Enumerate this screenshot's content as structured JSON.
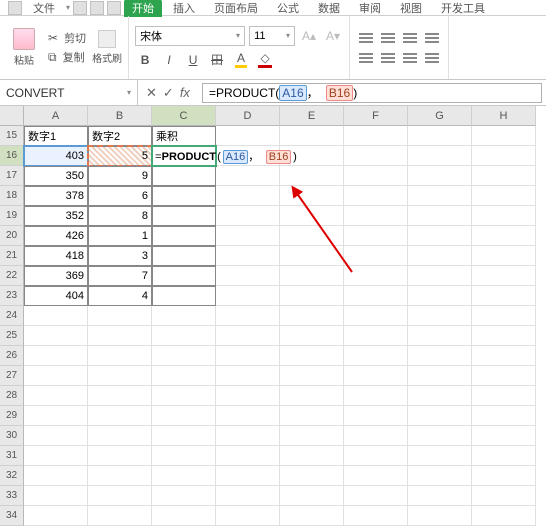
{
  "ribbon": {
    "file": "文件",
    "tabs": [
      "开始",
      "插入",
      "页面布局",
      "公式",
      "数据",
      "审阅",
      "视图",
      "开发工具"
    ],
    "active_index": 0
  },
  "clipboard": {
    "paste": "粘贴",
    "cut": "剪切",
    "copy": "复制",
    "format_painter": "格式刷"
  },
  "font": {
    "name": "宋体",
    "size": "11",
    "bold": "B",
    "italic": "I",
    "underline": "U",
    "strike": "S",
    "fill": "A",
    "color": "A"
  },
  "formula_bar": {
    "name_box": "CONVERT",
    "cancel": "✕",
    "confirm": "✓",
    "fx": "fx",
    "formula_prefix": "=PRODUCT(",
    "ref1": "A16",
    "comma": "，",
    "ref2": "B16",
    "formula_suffix": ")"
  },
  "columns": [
    "A",
    "B",
    "C",
    "D",
    "E",
    "F",
    "G",
    "H"
  ],
  "row_start": 15,
  "row_count": 20,
  "headers": {
    "A": "数字1",
    "B": "数字2",
    "C": "乘积"
  },
  "data_rows": [
    {
      "A": "403",
      "B": "5"
    },
    {
      "A": "350",
      "B": "9"
    },
    {
      "A": "378",
      "B": "6"
    },
    {
      "A": "352",
      "B": "8"
    },
    {
      "A": "426",
      "B": "1"
    },
    {
      "A": "418",
      "B": "3"
    },
    {
      "A": "369",
      "B": "7"
    },
    {
      "A": "404",
      "B": "4"
    }
  ],
  "edit_formula": {
    "prefix": "=",
    "fn": "PRODUCT",
    "open": "(",
    "ref1": "A16",
    "comma": "，",
    "ref2": "B16",
    "close": ")"
  },
  "col_widths": {
    "A": 64,
    "B": 64,
    "C": 64,
    "D": 64,
    "E": 64,
    "F": 64,
    "G": 64,
    "H": 64
  }
}
